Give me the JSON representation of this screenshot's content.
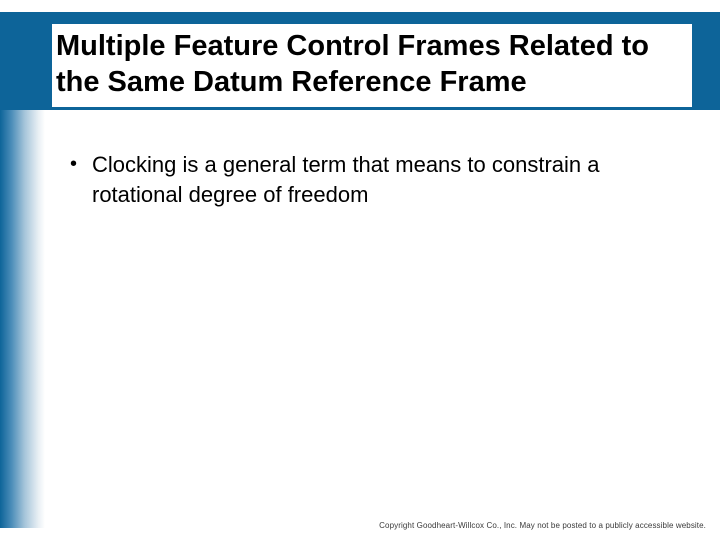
{
  "slide": {
    "title": "Multiple Feature Control Frames Related to the Same Datum Reference Frame",
    "bullets": [
      "Clocking is a general term that means to constrain a rotational degree of freedom"
    ],
    "footer": "Copyright Goodheart-Willcox Co., Inc.  May not be posted to a publicly accessible website."
  }
}
